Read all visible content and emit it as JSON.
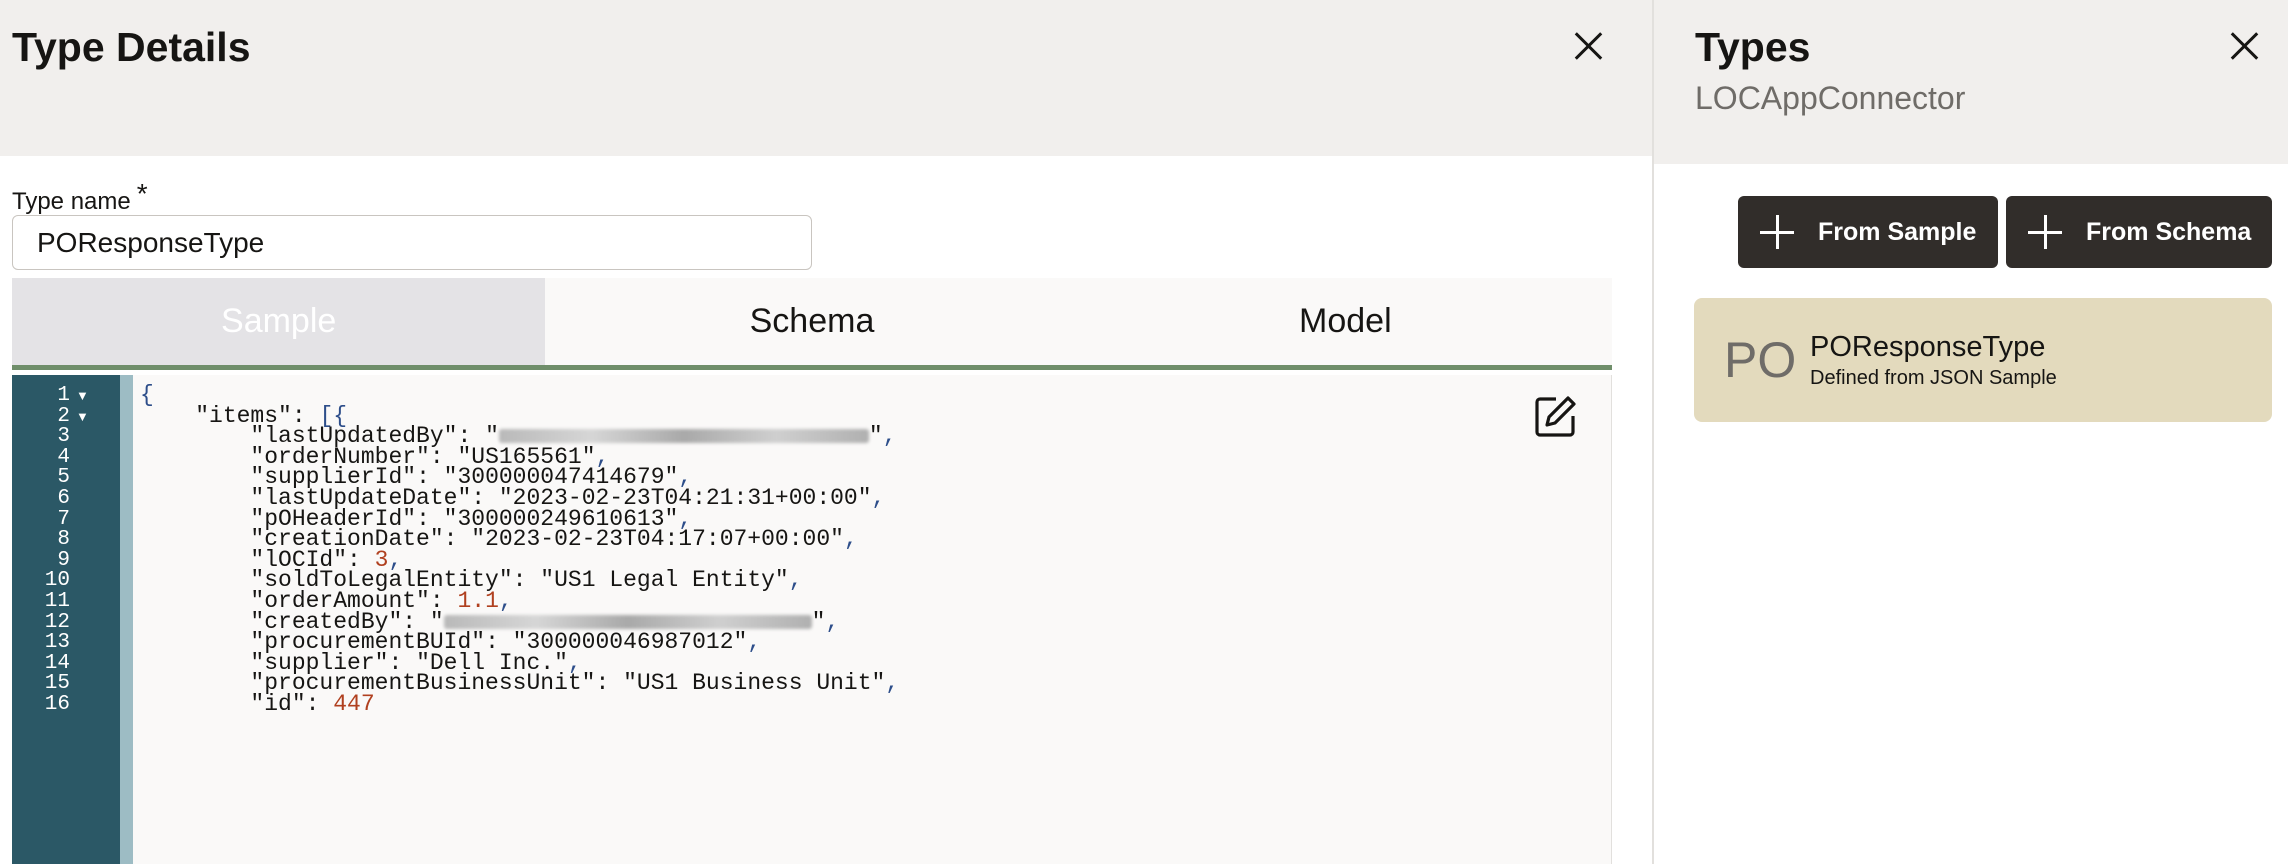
{
  "left_panel": {
    "title": "Type Details",
    "type_name_label": "Type name",
    "required_marker": "*",
    "type_name_value": "POResponseType",
    "tabs": [
      {
        "label": "Sample",
        "active": true
      },
      {
        "label": "Schema",
        "active": false
      },
      {
        "label": "Model",
        "active": false
      }
    ]
  },
  "editor": {
    "line_numbers": [
      "1",
      "2",
      "3",
      "4",
      "5",
      "6",
      "7",
      "8",
      "9",
      "10",
      "11",
      "12",
      "13",
      "14",
      "15",
      "16"
    ],
    "fold_marker": "▼",
    "lines": [
      {
        "indent": "",
        "key": "",
        "value": "",
        "raw": "{"
      },
      {
        "indent": "    ",
        "key": "\"items\"",
        "raw": ": [{"
      },
      {
        "indent": "        ",
        "key": "\"lastUpdatedBy\"",
        "value": "\"",
        "value_end": "\"",
        "blurred": true
      },
      {
        "indent": "        ",
        "key": "\"orderNumber\"",
        "value": "\"US165561\""
      },
      {
        "indent": "        ",
        "key": "\"supplierId\"",
        "value": "\"300000047414679\""
      },
      {
        "indent": "        ",
        "key": "\"lastUpdateDate\"",
        "value": "\"2023-02-23T04:21:31+00:00\""
      },
      {
        "indent": "        ",
        "key": "\"pOHeaderId\"",
        "value": "\"300000249610613\""
      },
      {
        "indent": "        ",
        "key": "\"creationDate\"",
        "value": "\"2023-02-23T04:17:07+00:00\""
      },
      {
        "indent": "        ",
        "key": "\"lOCId\"",
        "number": "3"
      },
      {
        "indent": "        ",
        "key": "\"soldToLegalEntity\"",
        "value": "\"US1 Legal Entity\""
      },
      {
        "indent": "        ",
        "key": "\"orderAmount\"",
        "number": "1.1"
      },
      {
        "indent": "        ",
        "key": "\"createdBy\"",
        "value": "\"",
        "value_end": "\"",
        "blurred": true
      },
      {
        "indent": "        ",
        "key": "\"procurementBUId\"",
        "value": "\"300000046987012\""
      },
      {
        "indent": "        ",
        "key": "\"supplier\"",
        "value": "\"Dell Inc.\""
      },
      {
        "indent": "        ",
        "key": "\"procurementBusinessUnit\"",
        "value": "\"US1 Business Unit\""
      },
      {
        "indent": "        ",
        "key": "\"id\"",
        "number": "447",
        "last": true
      }
    ]
  },
  "right_panel": {
    "title": "Types",
    "subtitle": "LOCAppConnector",
    "buttons": {
      "from_sample": "From Sample",
      "from_schema": "From Schema"
    },
    "type_card": {
      "abbr": "PO",
      "name": "POResponseType",
      "description": "Defined from JSON Sample"
    }
  },
  "colors": {
    "header_bg": "#f1efed",
    "gutter_bg": "#2b5866",
    "tab_underline": "#6f8e6a",
    "button_bg": "#312d2a",
    "card_bg": "#e3dabd",
    "number_color": "#b0401f"
  },
  "icons": {
    "close": "close-icon",
    "edit": "edit-icon",
    "plus": "plus-icon",
    "fold": "fold-arrow-icon"
  }
}
